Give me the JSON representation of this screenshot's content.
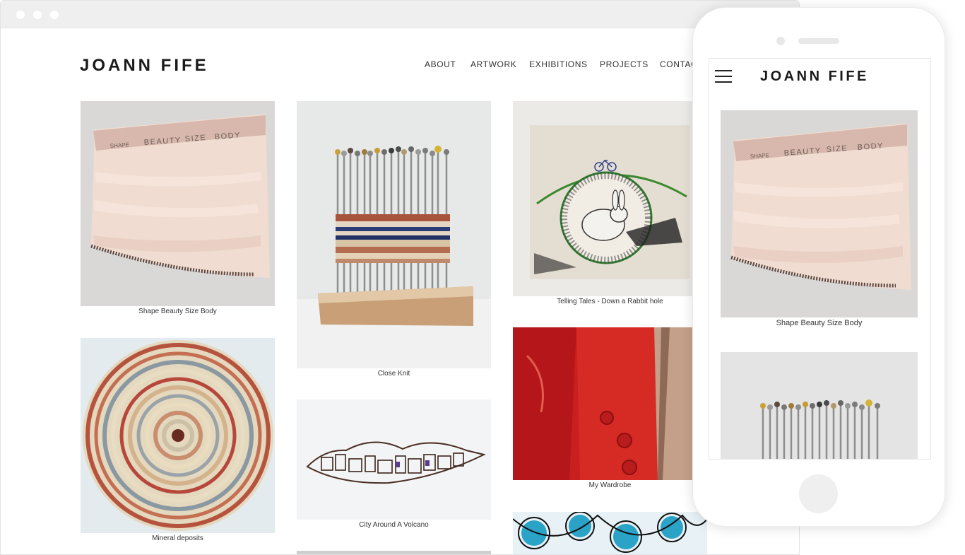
{
  "site": {
    "title": "JOANN FIFE"
  },
  "nav": {
    "about": "ABOUT",
    "artwork": "ARTWORK",
    "exhibitions": "EXHIBITIONS",
    "projects": "PROJECTS",
    "contact": "CONTACT"
  },
  "gallery": {
    "shape_beauty": "Shape Beauty Size Body",
    "mineral_deposits": "Mineral deposits",
    "close_knit": "Close Knit",
    "city_volcano": "City Around A Volcano",
    "telling_tales": "Telling Tales - Down a Rabbit hole",
    "my_wardrobe": "My Wardrobe"
  },
  "artwork_text": {
    "label_shape": "SHAPE",
    "label_beauty": "BEAUTY",
    "label_size": "SIZE",
    "label_body": "BODY"
  },
  "mobile": {
    "title": "JOANN FIFE",
    "caption_1": "Shape Beauty Size Body"
  },
  "icons": {
    "window_dots": "circle",
    "menu": "hamburger-icon"
  }
}
